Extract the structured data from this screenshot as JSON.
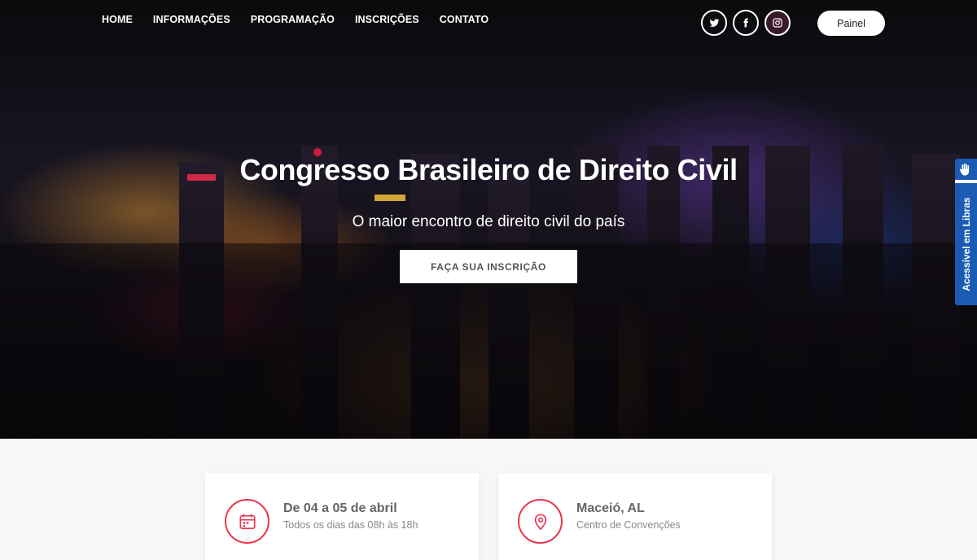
{
  "nav": {
    "items": [
      "HOME",
      "INFORMAÇÕES",
      "PROGRAMAÇÃO",
      "INSCRIÇÕES",
      "CONTATO"
    ]
  },
  "socials": [
    "twitter-icon",
    "facebook-icon",
    "instagram-icon"
  ],
  "painel_label": "Painel",
  "hero": {
    "title": "Congresso Brasileiro de Direito Civil",
    "subtitle": "O maior encontro de direito civil do país",
    "cta_label": "FAÇA SUA INSCRIÇÃO"
  },
  "libras": {
    "label": "Acessível em Libras",
    "icon": "sign-language-hand-icon"
  },
  "cards": [
    {
      "icon": "calendar-icon",
      "title": "De 04 a 05 de abril",
      "subtitle": "Todos os dias das 08h às 18h"
    },
    {
      "icon": "map-pin-icon",
      "title": "Maceió, AL",
      "subtitle": "Centro de Convenções"
    }
  ],
  "colors": {
    "accent": "#e8364f",
    "libras_blue": "#1a5bb4"
  }
}
